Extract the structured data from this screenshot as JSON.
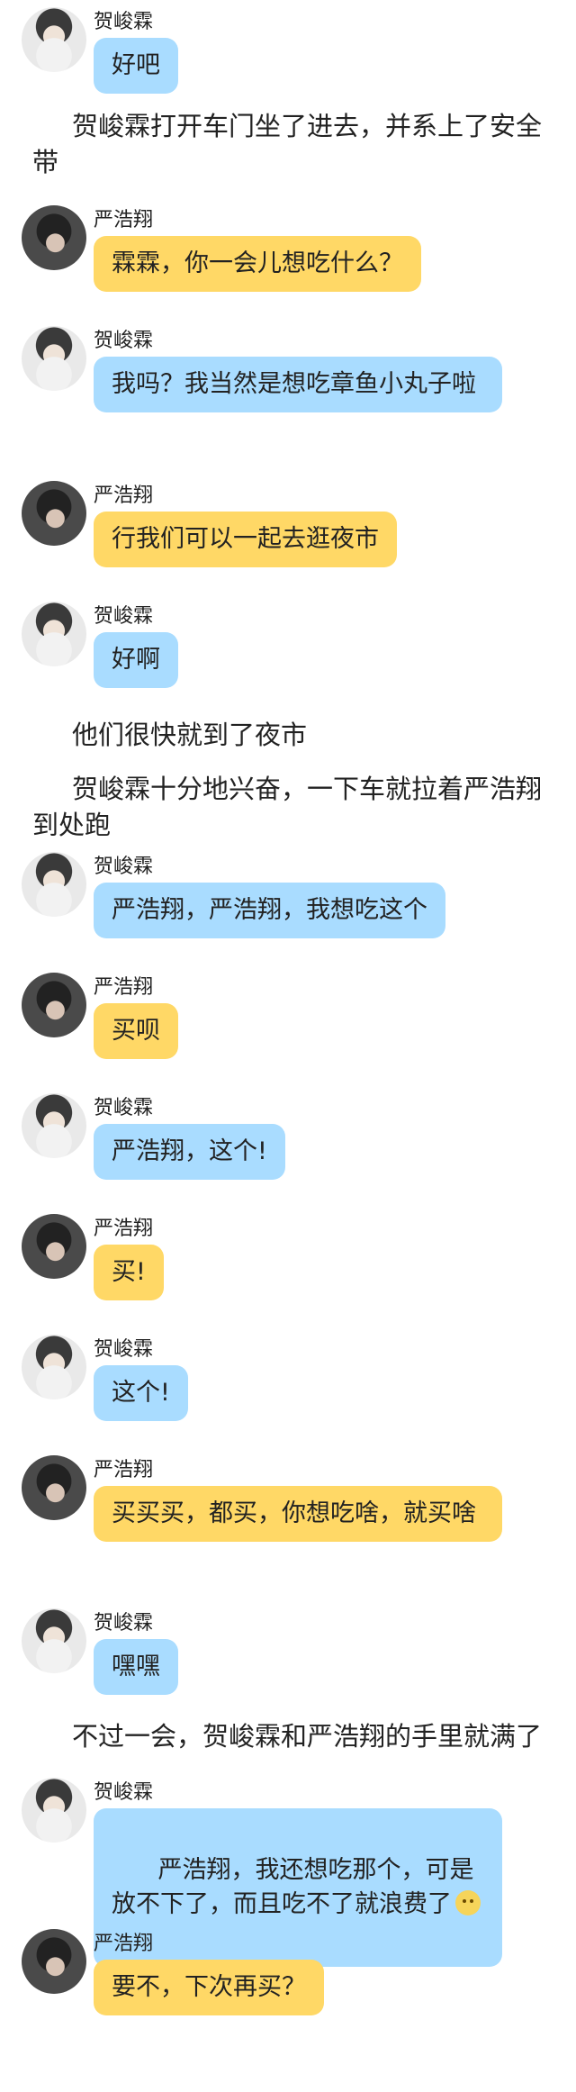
{
  "colors": {
    "he_bubble": "#a9dcff",
    "yan_bubble": "#ffd866",
    "background": "#ffffff"
  },
  "messages": [
    {
      "type": "chat",
      "speaker": "贺峻霖",
      "avatar": "he",
      "color": "blue",
      "text": "好吧"
    },
    {
      "type": "narration",
      "text": "贺峻霖打开车门坐了进去，并系上了安全带"
    },
    {
      "type": "chat",
      "speaker": "严浩翔",
      "avatar": "yan",
      "color": "yellow",
      "text": "霖霖，你一会儿想吃什么？"
    },
    {
      "type": "chat",
      "speaker": "贺峻霖",
      "avatar": "he",
      "color": "blue",
      "text": "我吗？我当然是想吃章鱼小丸子啦"
    },
    {
      "type": "chat",
      "speaker": "严浩翔",
      "avatar": "yan",
      "color": "yellow",
      "text": "行我们可以一起去逛夜市"
    },
    {
      "type": "chat",
      "speaker": "贺峻霖",
      "avatar": "he",
      "color": "blue",
      "text": "好啊"
    },
    {
      "type": "narration",
      "text": "他们很快就到了夜市"
    },
    {
      "type": "narration",
      "text": "贺峻霖十分地兴奋，一下车就拉着严浩翔到处跑"
    },
    {
      "type": "chat",
      "speaker": "贺峻霖",
      "avatar": "he",
      "color": "blue",
      "text": "严浩翔，严浩翔，我想吃这个"
    },
    {
      "type": "chat",
      "speaker": "严浩翔",
      "avatar": "yan",
      "color": "yellow",
      "text": "买呗"
    },
    {
      "type": "chat",
      "speaker": "贺峻霖",
      "avatar": "he",
      "color": "blue",
      "text": "严浩翔，这个!"
    },
    {
      "type": "chat",
      "speaker": "严浩翔",
      "avatar": "yan",
      "color": "yellow",
      "text": "买!"
    },
    {
      "type": "chat",
      "speaker": "贺峻霖",
      "avatar": "he",
      "color": "blue",
      "text": "这个!"
    },
    {
      "type": "chat",
      "speaker": "严浩翔",
      "avatar": "yan",
      "color": "yellow",
      "text": "买买买，都买，你想吃啥，就买啥"
    },
    {
      "type": "chat",
      "speaker": "贺峻霖",
      "avatar": "he",
      "color": "blue",
      "text": "嘿嘿"
    },
    {
      "type": "narration",
      "text": "不过一会，贺峻霖和严浩翔的手里就满了"
    },
    {
      "type": "chat",
      "speaker": "贺峻霖",
      "avatar": "he",
      "color": "blue",
      "text": "严浩翔，我还想吃那个，可是放不下了，而且吃不了就浪费了",
      "emoji": "sad-face-emoji"
    },
    {
      "type": "chat",
      "speaker": "严浩翔",
      "avatar": "yan",
      "color": "yellow",
      "text": "要不，下次再买？"
    }
  ]
}
